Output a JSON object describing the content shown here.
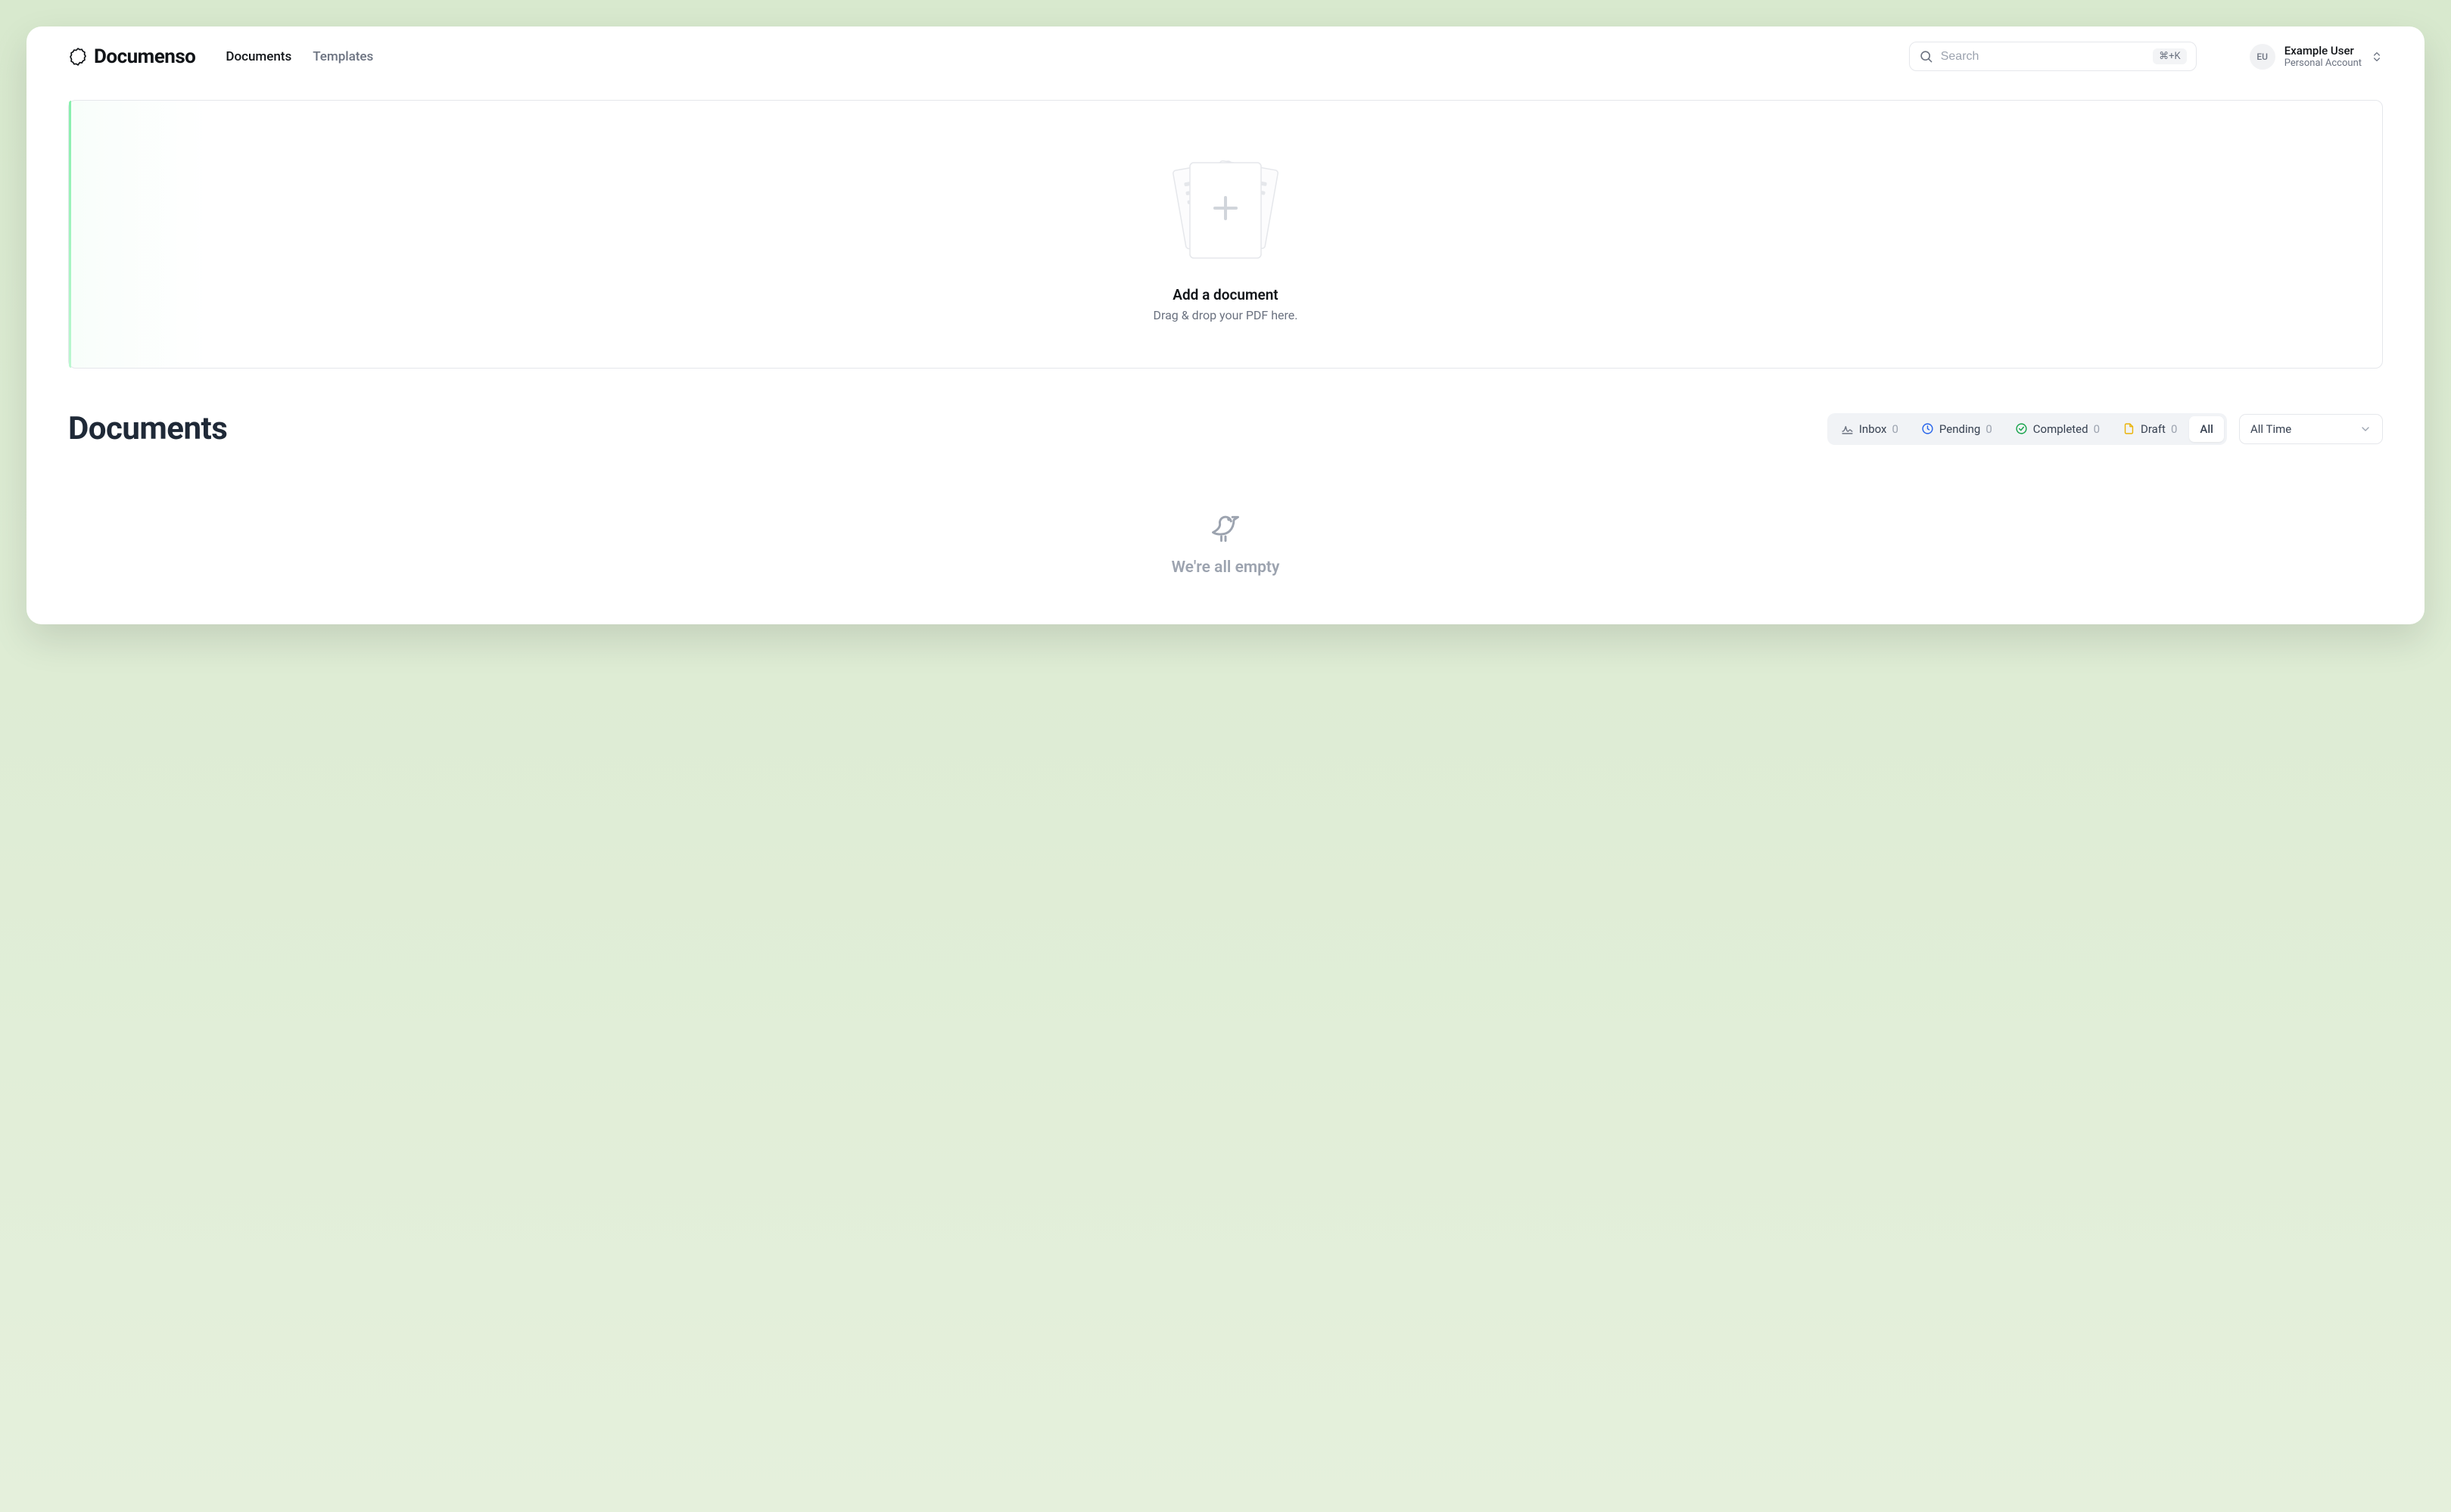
{
  "brand": {
    "name": "Documenso"
  },
  "nav": {
    "documents": "Documents",
    "templates": "Templates"
  },
  "search": {
    "placeholder": "Search",
    "shortcut": "⌘+K"
  },
  "account": {
    "initials": "EU",
    "name": "Example User",
    "sub": "Personal Account"
  },
  "dropzone": {
    "title": "Add a document",
    "subtitle": "Drag & drop your PDF here."
  },
  "page": {
    "heading": "Documents"
  },
  "filters": {
    "inbox": {
      "label": "Inbox",
      "count": "0",
      "icon_color": "#6b7280"
    },
    "pending": {
      "label": "Pending",
      "count": "0",
      "icon_color": "#2563eb"
    },
    "completed": {
      "label": "Completed",
      "count": "0",
      "icon_color": "#16a34a"
    },
    "draft": {
      "label": "Draft",
      "count": "0",
      "icon_color": "#eab308"
    },
    "all": {
      "label": "All"
    }
  },
  "time_filter": {
    "label": "All Time"
  },
  "empty": {
    "title": "We're all empty"
  }
}
